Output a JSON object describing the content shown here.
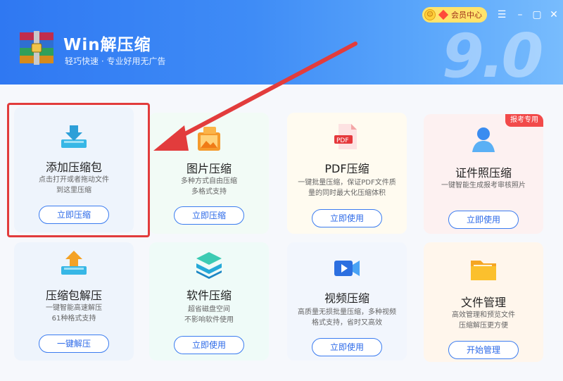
{
  "header": {
    "title": "Win解压缩",
    "subtitle": "轻巧快速 · 专业好用无广告",
    "version": "9.0",
    "member_label": "会员中心"
  },
  "cards": [
    {
      "title": "添加压缩包",
      "desc": [
        "点击打开或者拖动文件",
        "到这里压缩"
      ],
      "button": "立即压缩"
    },
    {
      "title": "图片压缩",
      "desc": [
        "多种方式自由压缩",
        "多格式支持"
      ],
      "button": "立即压缩"
    },
    {
      "title": "PDF压缩",
      "desc": [
        "一键批量压缩，保证PDF文件质",
        "量的同时最大化压缩体积"
      ],
      "button": "立即使用"
    },
    {
      "title": "证件照压缩",
      "desc": [
        "一键智能生成报考审核照片"
      ],
      "button": "立即使用",
      "badge": "报考专用"
    },
    {
      "title": "压缩包解压",
      "desc": [
        "一键智能高速解压",
        "61种格式支持"
      ],
      "button": "一键解压"
    },
    {
      "title": "软件压缩",
      "desc": [
        "超省磁盘空间",
        "不影响软件使用"
      ],
      "button": "立即使用"
    },
    {
      "title": "视频压缩",
      "desc": [
        "高质量无损批量压缩，多种视频",
        "格式支持，省时又高效"
      ],
      "button": "立即使用"
    },
    {
      "title": "文件管理",
      "desc": [
        "高效管理和预览文件",
        "压缩解压更方便"
      ],
      "button": "开始管理"
    }
  ],
  "colors": {
    "accent": "#2d6ae8",
    "header": "#3f8cf6",
    "highlight": "#e23c3c",
    "badge": "#f24a4a"
  },
  "icons": [
    "menu-icon",
    "minimize-icon",
    "maximize-icon",
    "close-icon"
  ]
}
